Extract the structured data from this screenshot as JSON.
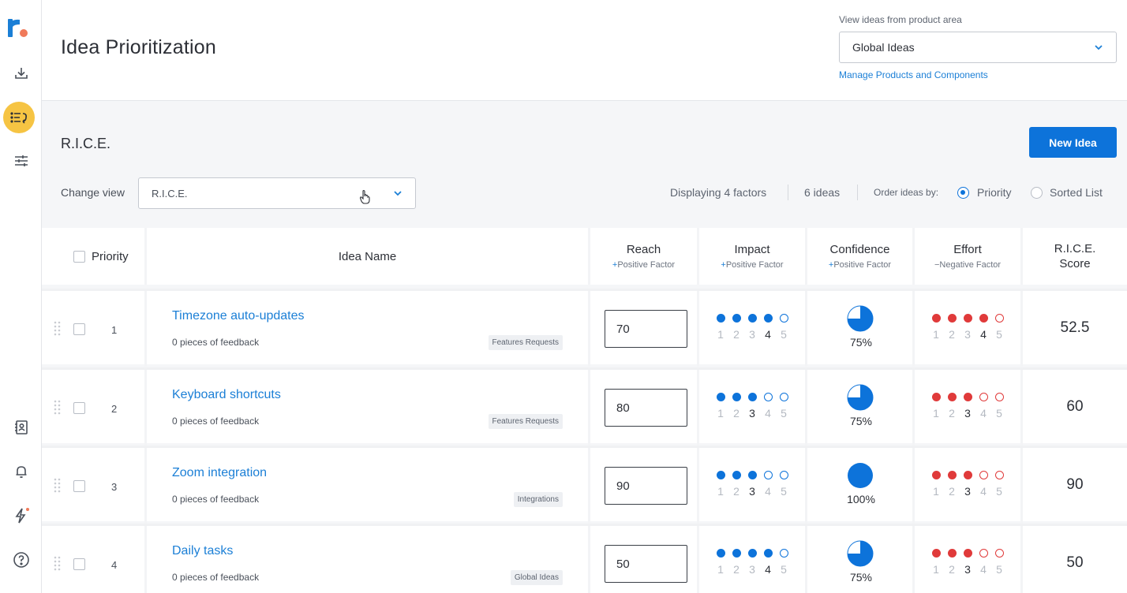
{
  "sidebar": {
    "icons": [
      "logo-icon",
      "download-icon",
      "prioritize-icon",
      "filter-icon",
      "contacts-icon",
      "bell-icon",
      "lightning-icon",
      "help-icon"
    ],
    "accent": "#f6c443"
  },
  "header": {
    "title": "Idea Prioritization",
    "area_label": "View ideas from product area",
    "area_value": "Global Ideas",
    "manage_link": "Manage Products and Components"
  },
  "toolbar": {
    "section_title": "R.I.C.E.",
    "new_idea_label": "New Idea",
    "change_view_label": "Change view",
    "change_view_value": "R.I.C.E.",
    "factors_text": "Displaying 4 factors",
    "ideas_text": "6 ideas",
    "order_label": "Order ideas by:",
    "order_options": [
      {
        "label": "Priority",
        "selected": true
      },
      {
        "label": "Sorted List",
        "selected": false
      }
    ]
  },
  "table": {
    "headers": {
      "priority": "Priority",
      "idea_name": "Idea Name",
      "reach": "Reach",
      "reach_sub": "Positive Factor",
      "impact": "Impact",
      "impact_sub": "Positive Factor",
      "confidence": "Confidence",
      "confidence_sub": "Positive Factor",
      "effort": "Effort",
      "effort_sub": "Negative Factor",
      "score_line1": "R.I.C.E.",
      "score_line2": "Score",
      "plus_sign": "+",
      "minus_sign": "−"
    },
    "scale": [
      "1",
      "2",
      "3",
      "4",
      "5"
    ],
    "impact_color": "#0d73da",
    "effort_color": "#e03a3a",
    "rows": [
      {
        "priority": "1",
        "name": "Timezone auto-updates",
        "feedback": "0 pieces of feedback",
        "tag": "Features Requests",
        "reach": "70",
        "impact": 4,
        "confidence": 75,
        "confidence_label": "75%",
        "effort": 4,
        "score": "52.5"
      },
      {
        "priority": "2",
        "name": "Keyboard shortcuts",
        "feedback": "0 pieces of feedback",
        "tag": "Features Requests",
        "reach": "80",
        "impact": 3,
        "confidence": 75,
        "confidence_label": "75%",
        "effort": 3,
        "score": "60"
      },
      {
        "priority": "3",
        "name": "Zoom integration",
        "feedback": "0 pieces of feedback",
        "tag": "Integrations",
        "reach": "90",
        "impact": 3,
        "confidence": 100,
        "confidence_label": "100%",
        "effort": 3,
        "score": "90"
      },
      {
        "priority": "4",
        "name": "Daily tasks",
        "feedback": "0 pieces of feedback",
        "tag": "Global Ideas",
        "reach": "50",
        "impact": 4,
        "confidence": 75,
        "confidence_label": "75%",
        "effort": 3,
        "score": "50"
      }
    ]
  }
}
